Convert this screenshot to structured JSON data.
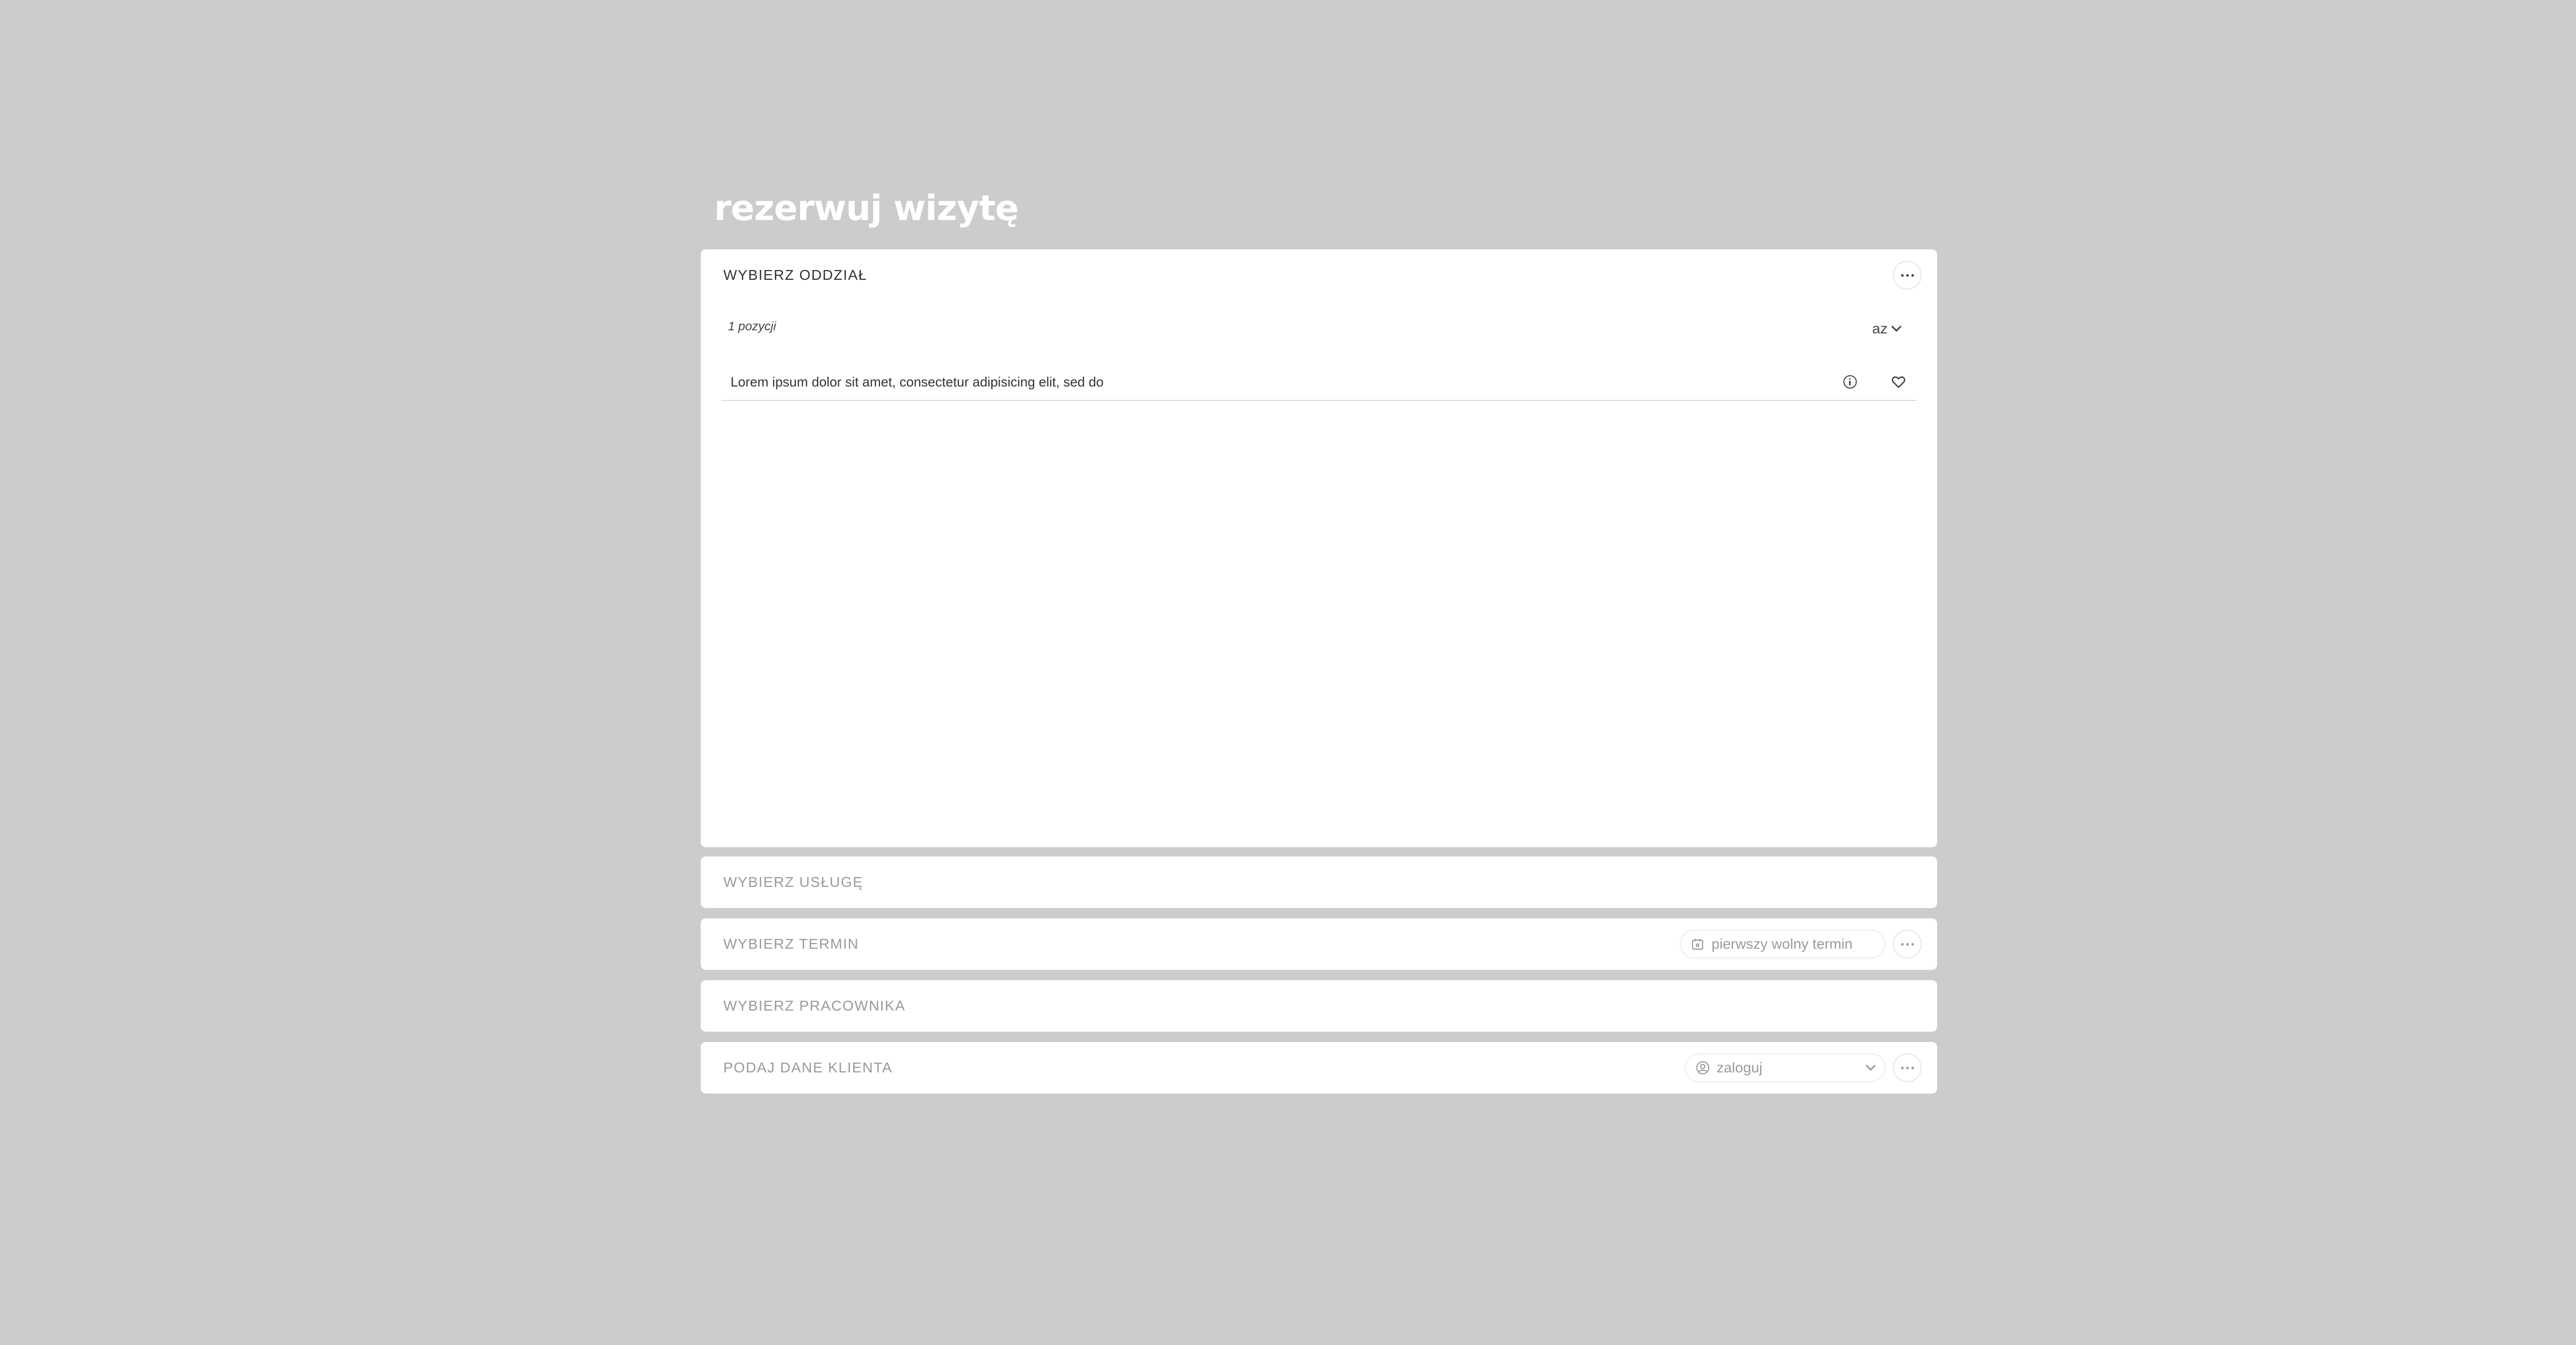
{
  "page": {
    "title": "rezerwuj wizytę"
  },
  "steps": {
    "oddzial": {
      "title": "WYBIERZ ODDZIAŁ",
      "count_label": "1 pozycji",
      "sort_label": "az",
      "items": [
        {
          "label": "Lorem ipsum dolor sit amet, consectetur adipisicing elit, sed do"
        }
      ]
    },
    "usluga": {
      "title": "WYBIERZ USŁUGĘ"
    },
    "termin": {
      "title": "WYBIERZ TERMIN",
      "pill_label": "pierwszy wolny termin"
    },
    "pracownik": {
      "title": "WYBIERZ PRACOWNIKA"
    },
    "klient": {
      "title": "PODAJ DANE KLIENTA",
      "login_label": "zaloguj"
    }
  },
  "icons": {
    "more": "more-dots-icon",
    "info": "info-icon",
    "favorite": "heart-icon",
    "calendar": "calendar-icon",
    "user": "user-circle-icon",
    "chevron": "chevron-down-icon"
  },
  "colors": {
    "background": "#cccccc",
    "panel": "#ffffff",
    "text": "#333333",
    "muted_text": "#9a9a9a"
  }
}
